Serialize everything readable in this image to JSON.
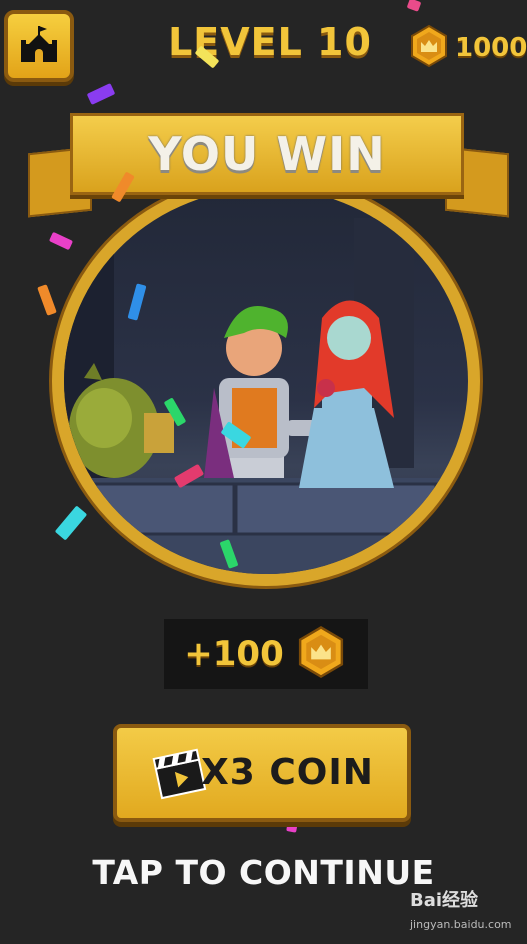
{
  "header": {
    "level_title": "LEVEL 10",
    "coin_total": "1000"
  },
  "banner": {
    "title": "YOU WIN"
  },
  "reward": {
    "amount": "+100"
  },
  "multiplier_button": {
    "label": "X3 COIN"
  },
  "footer": {
    "tap_to_continue": "TAP TO CONTINUE"
  },
  "watermark": {
    "brand": "Bai经验",
    "url": "jingyan.baidu.com"
  },
  "icons": [
    "castle-icon",
    "crown-coin-icon",
    "clapperboard-icon"
  ],
  "colors": {
    "gold": "#f2c53a",
    "background": "#252525",
    "ring": "#d9a62a"
  }
}
